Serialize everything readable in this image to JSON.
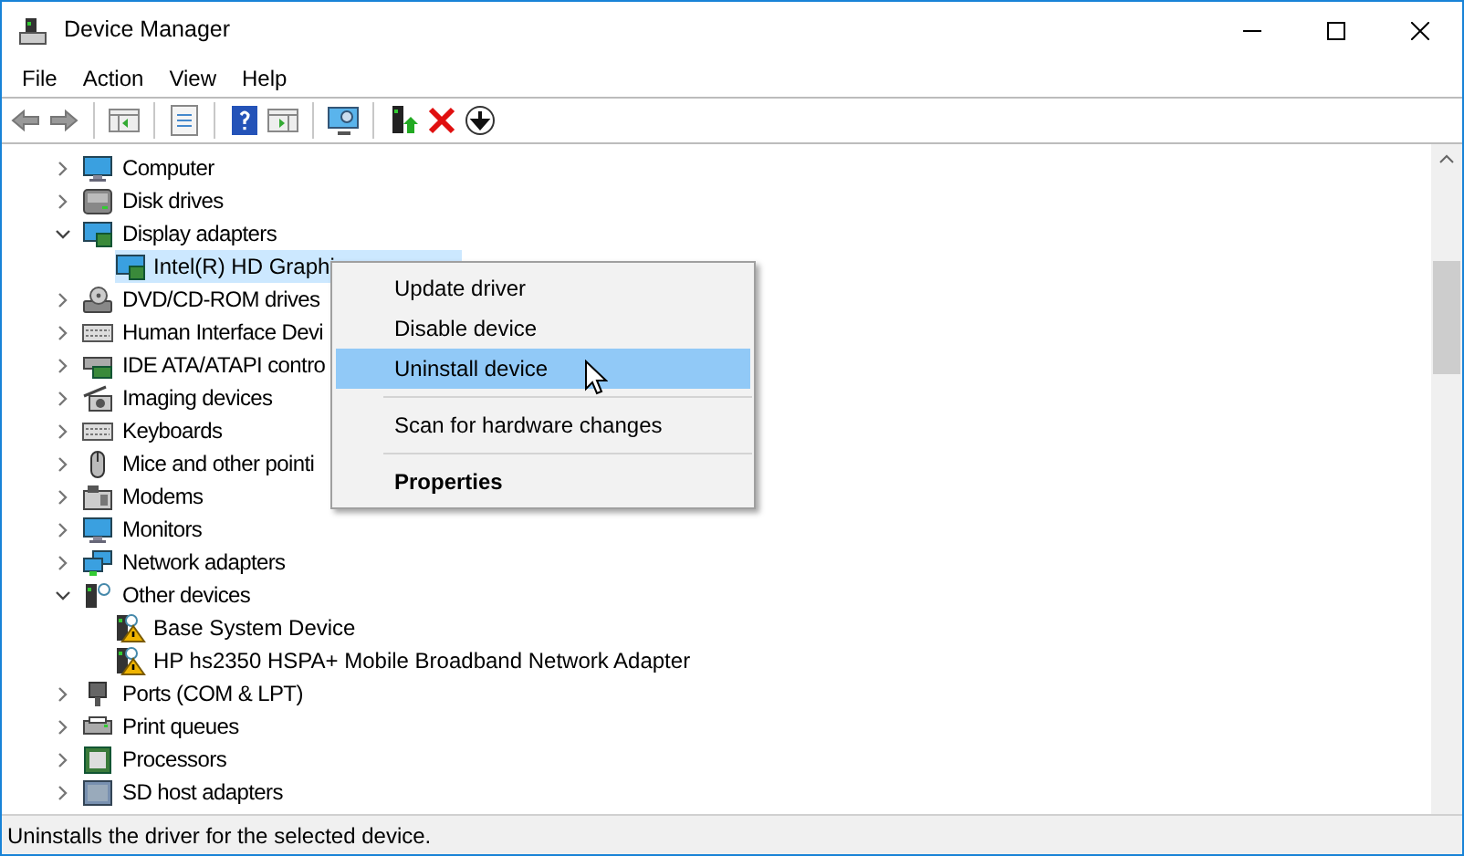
{
  "window": {
    "title": "Device Manager"
  },
  "menu": [
    "File",
    "Action",
    "View",
    "Help"
  ],
  "tree": [
    {
      "label": "Computer",
      "expanded": false,
      "selected": false
    },
    {
      "label": "Disk drives",
      "expanded": false,
      "selected": false
    },
    {
      "label": "Display adapters",
      "expanded": true,
      "selected": false,
      "children": [
        {
          "label": "Intel(R) HD Graphi",
          "selected": true,
          "warning": false
        }
      ]
    },
    {
      "label": "DVD/CD-ROM drives",
      "expanded": false,
      "selected": false
    },
    {
      "label": "Human Interface Devi",
      "expanded": false,
      "selected": false
    },
    {
      "label": "IDE ATA/ATAPI contro",
      "expanded": false,
      "selected": false
    },
    {
      "label": "Imaging devices",
      "expanded": false,
      "selected": false
    },
    {
      "label": "Keyboards",
      "expanded": false,
      "selected": false
    },
    {
      "label": "Mice and other pointi",
      "expanded": false,
      "selected": false
    },
    {
      "label": "Modems",
      "expanded": false,
      "selected": false
    },
    {
      "label": "Monitors",
      "expanded": false,
      "selected": false
    },
    {
      "label": "Network adapters",
      "expanded": false,
      "selected": false
    },
    {
      "label": "Other devices",
      "expanded": true,
      "selected": false,
      "children": [
        {
          "label": "Base System Device",
          "selected": false,
          "warning": true
        },
        {
          "label": "HP hs2350 HSPA+ Mobile Broadband Network Adapter",
          "selected": false,
          "warning": true
        }
      ]
    },
    {
      "label": "Ports (COM & LPT)",
      "expanded": false,
      "selected": false
    },
    {
      "label": "Print queues",
      "expanded": false,
      "selected": false
    },
    {
      "label": "Processors",
      "expanded": false,
      "selected": false
    },
    {
      "label": "SD host adapters",
      "expanded": false,
      "selected": false
    }
  ],
  "context_menu": [
    {
      "kind": "item",
      "label": "Update driver",
      "selected": false,
      "bold": false
    },
    {
      "kind": "item",
      "label": "Disable device",
      "selected": false,
      "bold": false
    },
    {
      "kind": "item",
      "label": "Uninstall device",
      "selected": true,
      "bold": false
    },
    {
      "kind": "separator"
    },
    {
      "kind": "item",
      "label": "Scan for hardware changes",
      "selected": false,
      "bold": false
    },
    {
      "kind": "separator"
    },
    {
      "kind": "item",
      "label": "Properties",
      "selected": false,
      "bold": true
    }
  ],
  "status_bar": "Uninstalls the driver for the selected device."
}
